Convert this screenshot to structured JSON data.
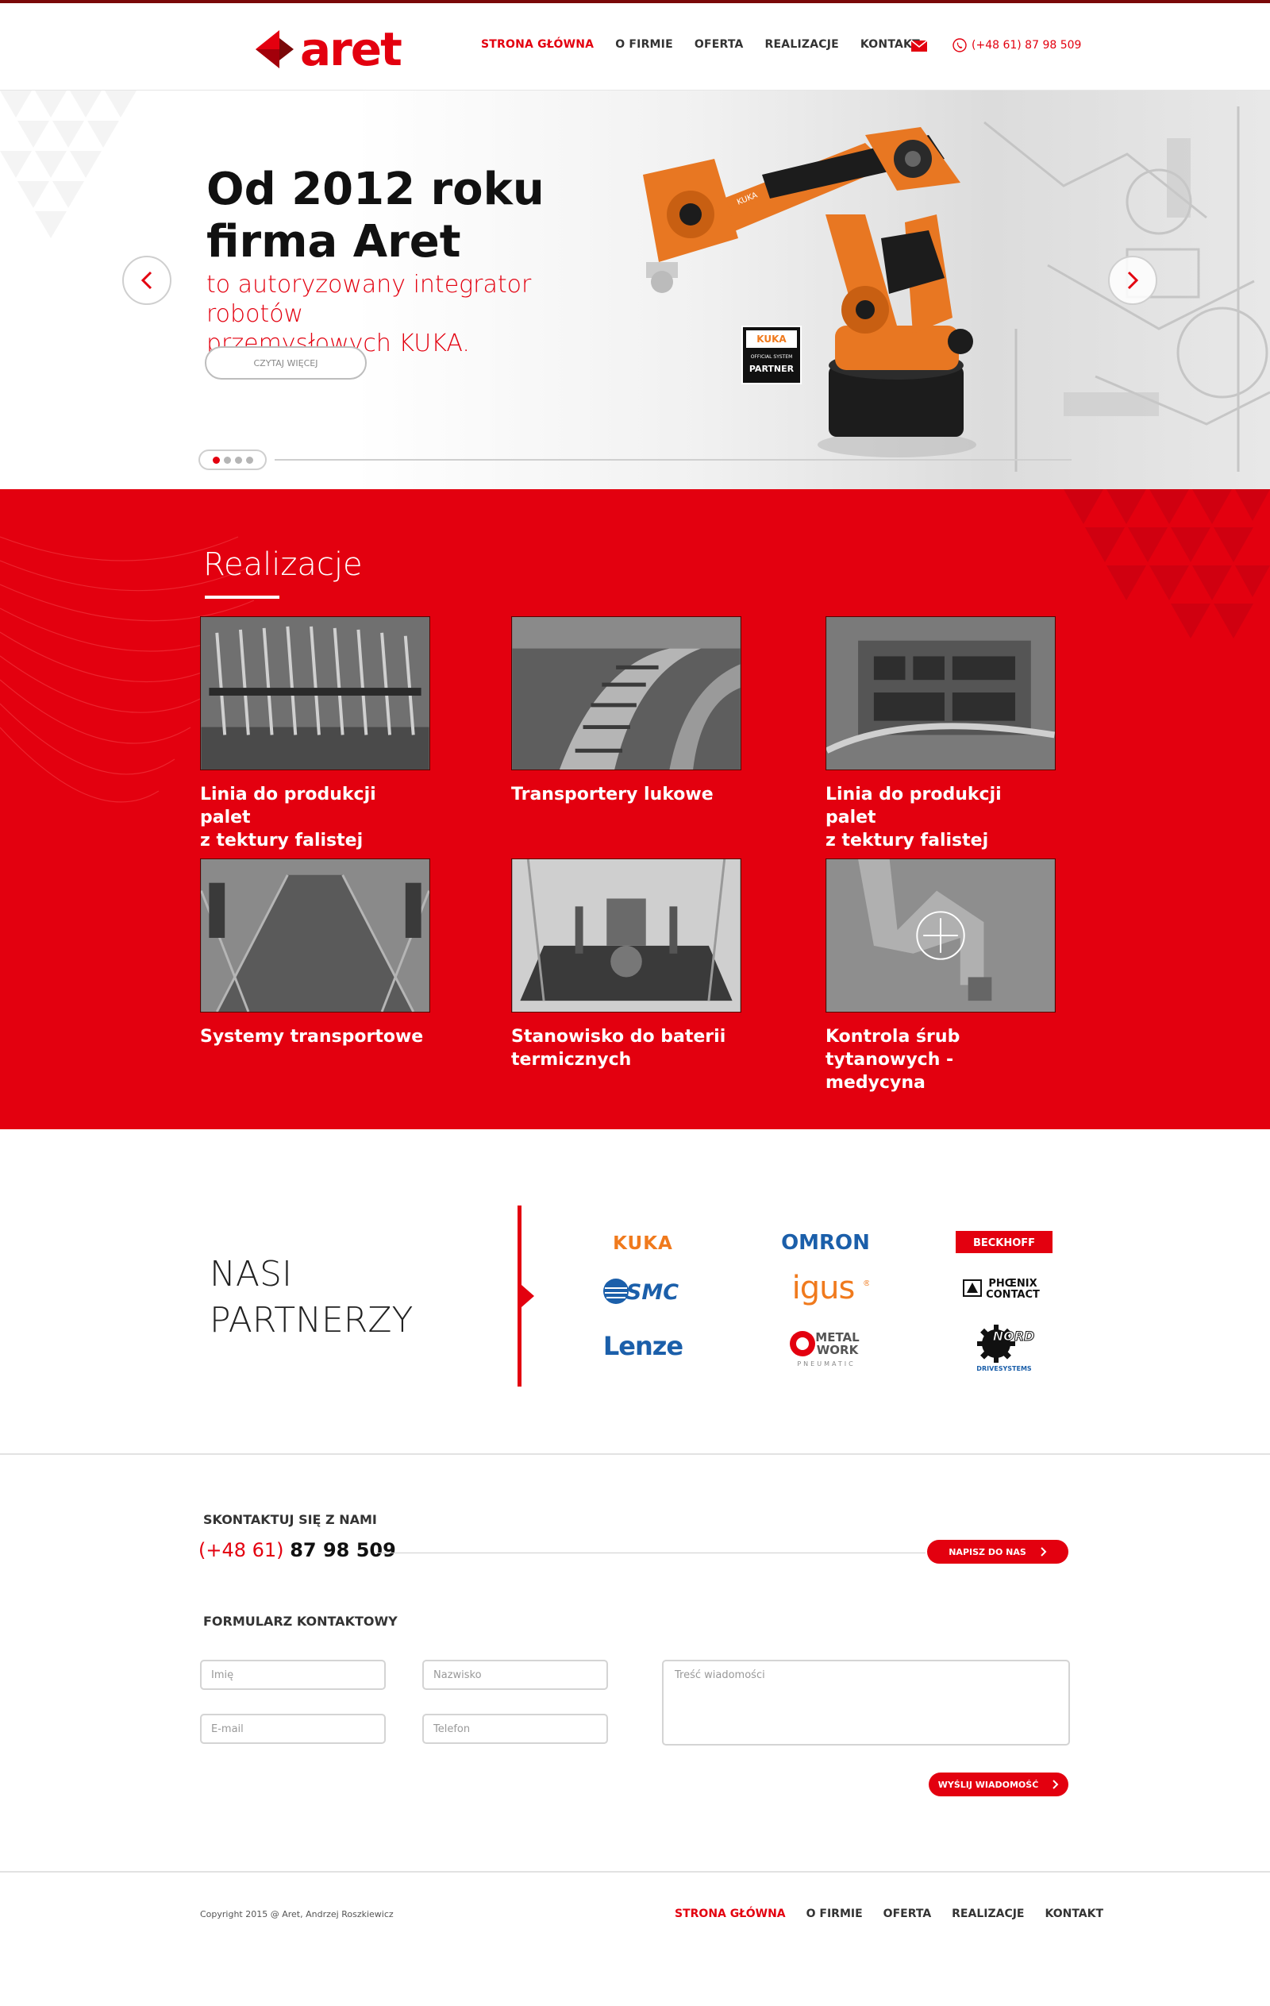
{
  "brand": {
    "name": "aret",
    "accent_color": "#e3000f",
    "dark_accent_color": "#7a0808"
  },
  "nav": {
    "items": [
      {
        "label": "STRONA GŁÓWNA",
        "active": true
      },
      {
        "label": "O FIRMIE",
        "active": false
      },
      {
        "label": "OFERTA",
        "active": false
      },
      {
        "label": "REALIZACJE",
        "active": false
      },
      {
        "label": "KONTAKT",
        "active": false
      }
    ],
    "email_icon": "envelope-icon",
    "phone_icon": "phone-icon",
    "phone": "(+48 61) 87 98 509"
  },
  "hero": {
    "title": "Od 2012 roku\nfirma Aret",
    "subtitle": "to autoryzowany integrator robotów\nprzemysłowych KUKA.",
    "button_label": "CZYTAJ WIĘCEJ",
    "prev_icon": "chevron-left-icon",
    "next_icon": "chevron-right-icon",
    "slides_count": 4,
    "active_slide": 1,
    "badge": {
      "brand": "KUKA",
      "line1": "OFFICIAL SYSTEM",
      "line2": "PARTNER"
    }
  },
  "realizacje": {
    "title": "Realizacje",
    "items": [
      {
        "title": "Linia do produkcji palet\nz tektury falistej"
      },
      {
        "title": "Transportery lukowe"
      },
      {
        "title": "Linia do produkcji palet\nz tektury falistej"
      },
      {
        "title": "Systemy transportowe"
      },
      {
        "title": "Stanowisko do baterii\ntermicznych"
      },
      {
        "title": "Kontrola śrub\ntytanowych - medycyna"
      }
    ]
  },
  "partners": {
    "title": "NASI\nPARTNERZY",
    "logos": [
      {
        "name": "KUKA",
        "color": "#f07a1d"
      },
      {
        "name": "OMRON",
        "color": "#1b5faa"
      },
      {
        "name": "BECKHOFF",
        "color": "#e3000f"
      },
      {
        "name": "SMC",
        "color": "#1b5faa"
      },
      {
        "name": "igus",
        "color": "#f07a1d"
      },
      {
        "name": "PHOENIX CONTACT",
        "color": "#111111"
      },
      {
        "name": "Lenze",
        "color": "#1b5faa"
      },
      {
        "name": "METAL WORK",
        "sub": "PNEUMATIC",
        "color": "#555555"
      },
      {
        "name": "NORD",
        "sub": "DRIVESYSTEMS",
        "color": "#111111"
      }
    ]
  },
  "contact": {
    "heading": "SKONTAKTUJ SIĘ Z NAMI",
    "phone_prefix": "(+48 61)",
    "phone_number": "87 98 509",
    "write_button": "NAPISZ DO NAS",
    "form_heading": "FORMULARZ KONTAKTOWY",
    "fields": {
      "name": "Imię",
      "surname": "Nazwisko",
      "email": "E-mail",
      "phone": "Telefon",
      "message": "Treść wiadomości"
    },
    "send_button": "WYŚLIJ WIADOMOŚĆ"
  },
  "footer": {
    "copyright": "Copyright 2015 @ Aret, Andrzej Roszkiewicz",
    "nav": [
      {
        "label": "STRONA GŁÓWNA",
        "active": true
      },
      {
        "label": "O FIRMIE",
        "active": false
      },
      {
        "label": "OFERTA",
        "active": false
      },
      {
        "label": "REALIZACJE",
        "active": false
      },
      {
        "label": "KONTAKT",
        "active": false
      }
    ]
  }
}
